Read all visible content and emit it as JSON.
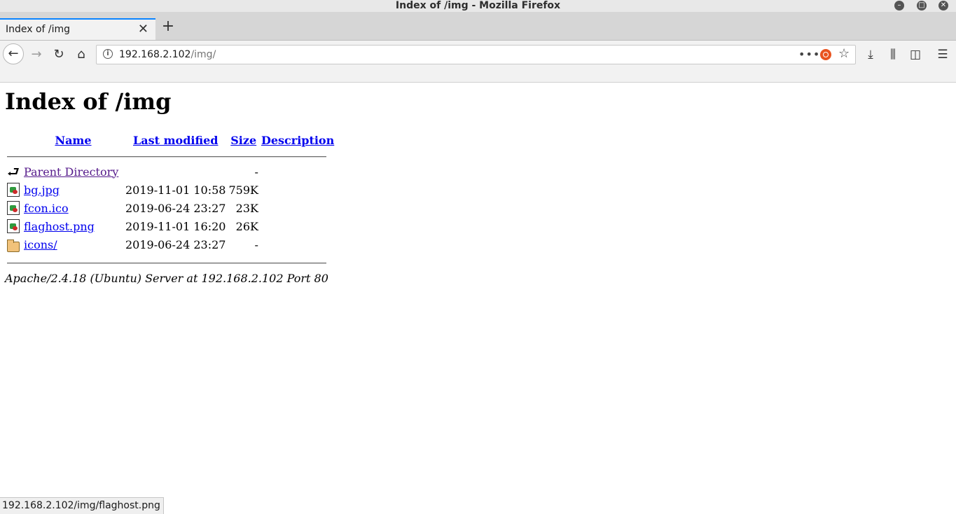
{
  "window": {
    "title": "Index of /img - Mozilla Firefox"
  },
  "tabs": [
    {
      "title": "Index of /img"
    }
  ],
  "navbar": {
    "url_host": "192.168.2.102",
    "url_path": "/img/"
  },
  "page": {
    "heading": "Index of /img",
    "columns": {
      "name": "Name",
      "modified": "Last modified",
      "size": "Size",
      "description": "Description"
    },
    "rows": [
      {
        "name": "Parent Directory",
        "modified": "",
        "size": "-",
        "description": "",
        "icon": "back-icon"
      },
      {
        "name": "bg.jpg",
        "modified": "2019-11-01 10:58",
        "size": "759K",
        "description": "",
        "icon": "image-file-icon"
      },
      {
        "name": "fcon.ico",
        "modified": "2019-06-24 23:27",
        "size": "23K",
        "description": "",
        "icon": "image-file-icon"
      },
      {
        "name": "flaghost.png",
        "modified": "2019-11-01 16:20",
        "size": "26K",
        "description": "",
        "icon": "image-file-icon"
      },
      {
        "name": "icons/",
        "modified": "2019-06-24 23:27",
        "size": "-",
        "description": "",
        "icon": "folder-icon"
      }
    ],
    "address": "Apache/2.4.18 (Ubuntu) Server at 192.168.2.102 Port 80"
  },
  "status": {
    "hover_url": "192.168.2.102/img/flaghost.png"
  },
  "colors": {
    "link": "#0000ee",
    "visited": "#551a8b",
    "tab_accent": "#0a84ff",
    "ubuntu": "#e95420"
  }
}
